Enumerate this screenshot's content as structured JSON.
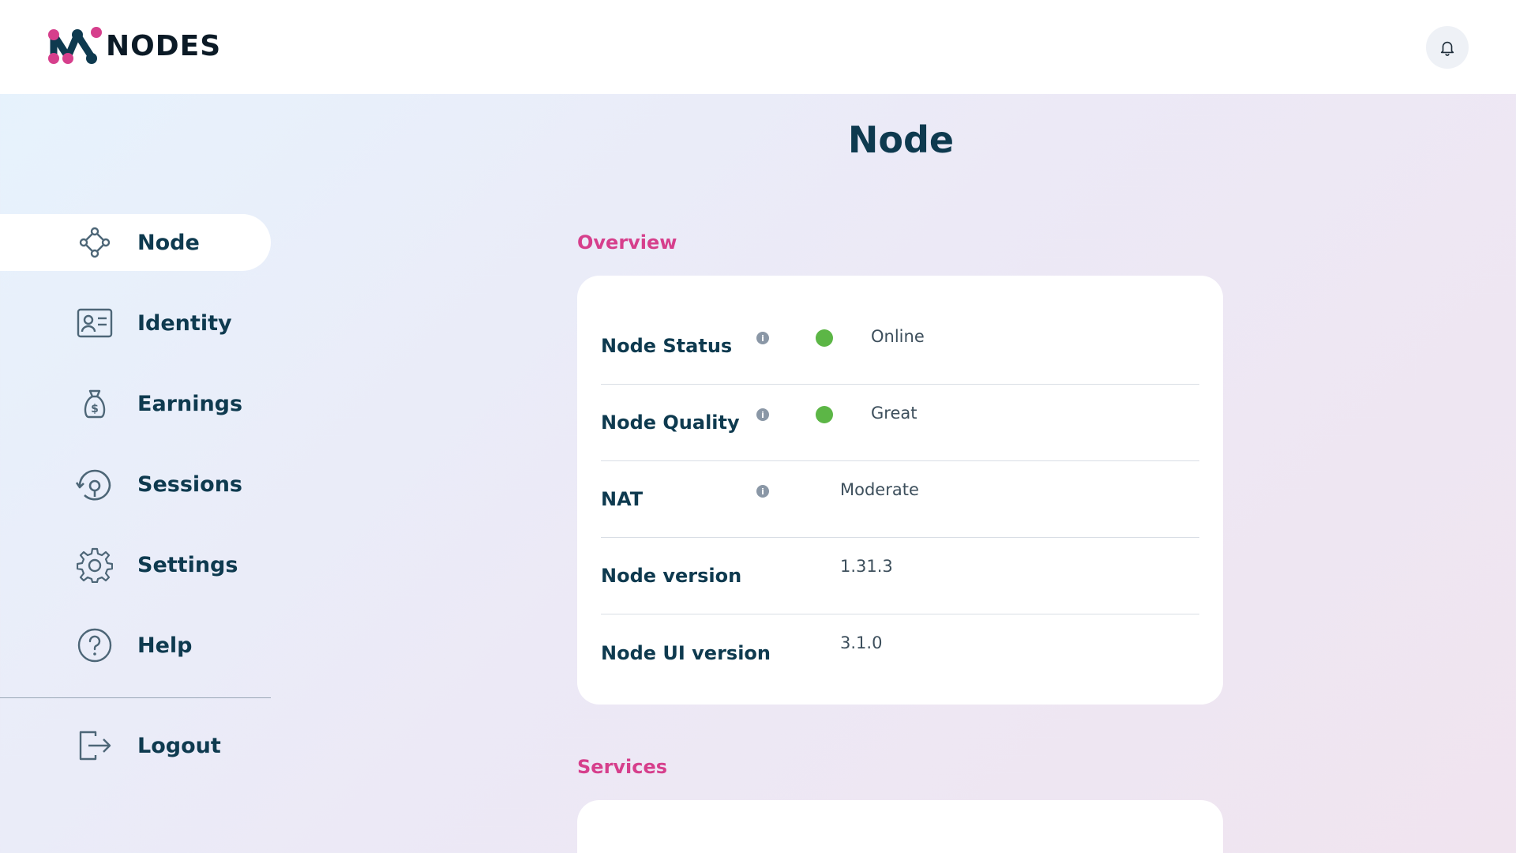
{
  "app": {
    "brand": "NODES"
  },
  "page": {
    "title": "Node"
  },
  "sidebar": {
    "items": [
      {
        "label": "Node",
        "icon": "node-icon",
        "active": true
      },
      {
        "label": "Identity",
        "icon": "identity-card-icon",
        "active": false
      },
      {
        "label": "Earnings",
        "icon": "money-bag-icon",
        "active": false
      },
      {
        "label": "Sessions",
        "icon": "sessions-icon",
        "active": false
      },
      {
        "label": "Settings",
        "icon": "gear-icon",
        "active": false
      },
      {
        "label": "Help",
        "icon": "help-icon",
        "active": false
      }
    ],
    "logout": {
      "label": "Logout",
      "icon": "logout-icon"
    }
  },
  "overview": {
    "heading": "Overview",
    "rows": [
      {
        "label": "Node Status",
        "value": "Online",
        "status_color": "#5cb646",
        "has_info": true
      },
      {
        "label": "Node Quality",
        "value": "Great",
        "status_color": "#5cb646",
        "has_info": true
      },
      {
        "label": "NAT",
        "value": "Moderate",
        "has_info": true
      },
      {
        "label": "Node version",
        "value": "1.31.3",
        "has_info": false
      },
      {
        "label": "Node UI version",
        "value": "3.1.0",
        "has_info": false
      }
    ]
  },
  "services": {
    "heading": "Services"
  },
  "colors": {
    "accent": "#d63f8c",
    "text_dark": "#0e3a4f",
    "status_green": "#5cb646",
    "logo_pink": "#d63f8c",
    "logo_dark": "#0e3a4f"
  }
}
